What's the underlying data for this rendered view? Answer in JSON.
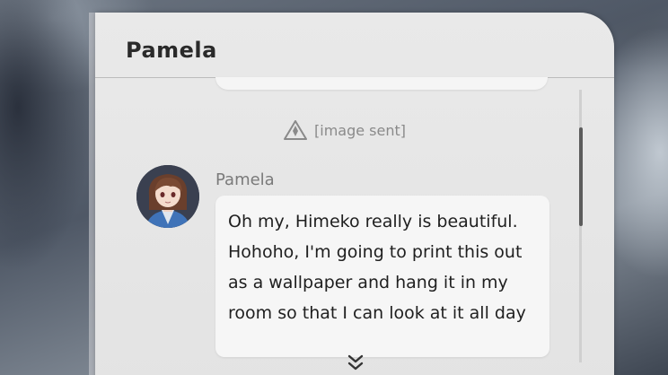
{
  "chat": {
    "title": "Pamela",
    "system_message": "[image sent]",
    "messages": [
      {
        "sender": "Pamela",
        "text": "Oh my, Himeko really is beautiful. Hohoho, I'm going to print this out as a wallpaper and hang it in my room so that I can look at it all day"
      }
    ]
  },
  "icons": {
    "image_sent": "image-sent-icon",
    "more": "chevron-double-down-icon"
  },
  "colors": {
    "panel": "#e6e6e6",
    "bubble": "#f6f6f6",
    "text": "#1f1f1f",
    "muted": "#8a8a8a"
  }
}
